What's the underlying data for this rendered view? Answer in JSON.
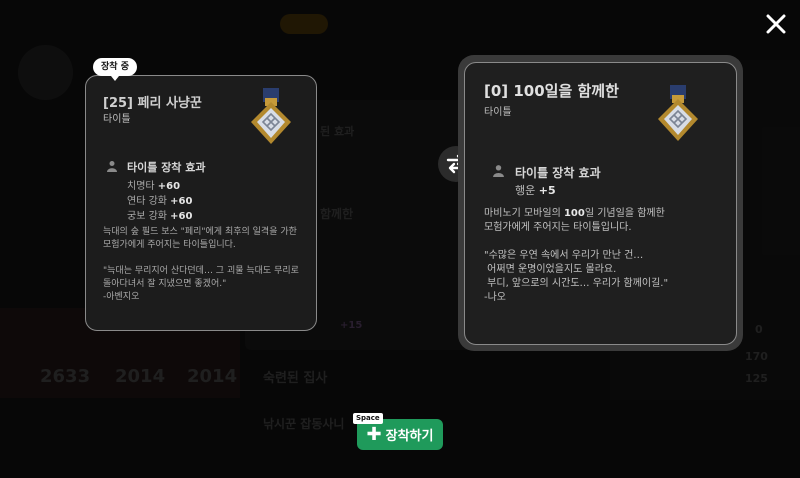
{
  "background": {
    "stats": [
      "2633",
      "2014",
      "2014"
    ],
    "list_items": [
      "숙련된 집사",
      "낚시꾼 잡동사니"
    ],
    "middle_labels": [
      "된 효과",
      "함께한"
    ],
    "right_numbers": [
      "0",
      "170",
      "125"
    ],
    "small_value": "+15"
  },
  "close_icon": "close-icon",
  "badge": {
    "label": "장착 중"
  },
  "current_title": {
    "name": "[25] 페리 사냥꾼",
    "type": "타이틀",
    "effect_header": "타이틀 장착 효과",
    "stats": [
      {
        "label": "치명타",
        "value": "+60"
      },
      {
        "label": "연타 강화",
        "value": "+60"
      },
      {
        "label": "궁보 강화",
        "value": "+60"
      }
    ],
    "description": "늑대의 숲 필드 보스 \"페리\"에게 최후의 일격을 가한\n모험가에게 주어지는 타이틀입니다.\n\n\"늑대는 무리지어 산다던데… 그 괴물 늑대도 무리로\n돌아다녀서 잘 지냈으면 좋겠어.\"\n-아벤지오"
  },
  "new_title": {
    "name": "[0] 100일을 함께한",
    "type": "타이틀",
    "effect_header": "타이틀 장착 효과",
    "stats": [
      {
        "label": "행운",
        "value": "+5"
      }
    ],
    "description_line1_pre": "마비노기 모바일의 ",
    "description_line1_bold": "100",
    "description_line1_post": "일 기념일을 함께한",
    "description_rest": "모험가에게 주어지는 타이틀입니다.\n\n\"수많은 우연 속에서 우리가 만난 건…\n 어쩌면 운명이었을지도 몰라요.\n 부디, 앞으로의 시간도… 우리가 함께이길.\"\n-나오"
  },
  "swap_icon": "swap-arrows-icon",
  "equip_button": {
    "label": "장착하기",
    "key_hint": "Space"
  },
  "colors": {
    "accent": "#1f9a5b"
  }
}
